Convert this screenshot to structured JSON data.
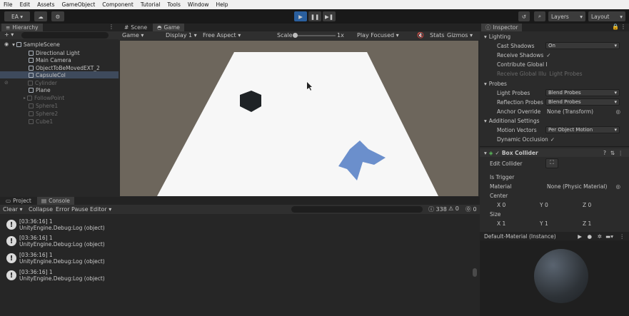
{
  "menu": [
    "File",
    "Edit",
    "Assets",
    "GameObject",
    "Component",
    "Tutorial",
    "Tools",
    "Window",
    "Help"
  ],
  "toolbar": {
    "account": "EA",
    "layers": "Layers",
    "layout": "Layout"
  },
  "hierarchy": {
    "tab": "Hierarchy",
    "scene": "SampleScene",
    "items": [
      {
        "label": "Directional Light",
        "dim": false
      },
      {
        "label": "Main Camera",
        "dim": false
      },
      {
        "label": "ObjectToBeMovedEXT_2",
        "dim": false
      },
      {
        "label": "CapsuleCol",
        "dim": false
      },
      {
        "label": "Cylinder",
        "dim": true
      },
      {
        "label": "Plane",
        "dim": false
      },
      {
        "label": "FollowPoint",
        "dim": true
      },
      {
        "label": "Sphere1",
        "dim": true
      },
      {
        "label": "Sphere2",
        "dim": true
      },
      {
        "label": "Cube1",
        "dim": true
      }
    ]
  },
  "game": {
    "tabs": [
      "Scene",
      "Game"
    ],
    "mode": "Game",
    "display": "Display 1",
    "aspect": "Free Aspect",
    "scale_label": "Scale",
    "scale_value": "1x",
    "play_focused": "Play Focused",
    "stats": "Stats",
    "gizmos": "Gizmos"
  },
  "inspector": {
    "tab": "Inspector",
    "lighting": "Lighting",
    "rows": [
      {
        "label": "Cast Shadows",
        "value": "On"
      },
      {
        "label": "Receive Shadows",
        "value": "✓"
      },
      {
        "label": "Contribute Global I",
        "value": ""
      },
      {
        "label": "Receive Global Illu",
        "value": "Light Probes"
      }
    ],
    "probes": "Probes",
    "probe_rows": [
      {
        "label": "Light Probes",
        "value": "Blend Probes"
      },
      {
        "label": "Reflection Probes",
        "value": "Blend Probes"
      },
      {
        "label": "Anchor Override",
        "value": "None (Transform)"
      }
    ],
    "additional": "Additional Settings",
    "add_rows": [
      {
        "label": "Motion Vectors",
        "value": "Per Object Motion"
      },
      {
        "label": "Dynamic Occlusion",
        "value": "✓"
      }
    ],
    "box_collider": "Box Collider",
    "edit_collider": "Edit Collider",
    "is_trigger": "Is Trigger",
    "material_label": "Material",
    "material_value": "None (Physic Material)",
    "center": "Center",
    "size": "Size",
    "center_xyz": [
      "X 0",
      "Y 0",
      "Z 0"
    ],
    "size_xyz": [
      "X 1",
      "Y 1",
      "Z 1"
    ],
    "material_preview": "Default-Material (Instance)"
  },
  "console": {
    "tabs": [
      "Project",
      "Console"
    ],
    "clear": "Clear",
    "collapse": "Collapse",
    "error_pause": "Error Pause",
    "editor": "Editor",
    "count_info": "338",
    "count_warn": "0",
    "count_error": "0",
    "logs": [
      {
        "time": "[03:36:16] 1",
        "detail": "UnityEngine.Debug:Log (object)"
      },
      {
        "time": "[03:36:16] 1",
        "detail": "UnityEngine.Debug:Log (object)"
      },
      {
        "time": "[03:36:16] 1",
        "detail": "UnityEngine.Debug:Log (object)"
      },
      {
        "time": "[03:36:16] 1",
        "detail": "UnityEngine.Debug:Log (object)"
      }
    ]
  },
  "colors": {
    "accent_play": "#2a5f9e",
    "floor": "#f7f7f7",
    "cube": "#1f2326",
    "flag": "#6b8fcc"
  }
}
